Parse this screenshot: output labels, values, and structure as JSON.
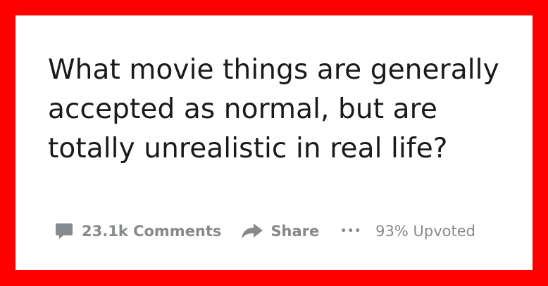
{
  "post": {
    "title": "What movie things are generally accepted as normal, but are totally unrealistic in real life?"
  },
  "actions": {
    "comments_label": "23.1k Comments",
    "share_label": "Share",
    "more_label": "•••",
    "upvoted_label": "93% Upvoted"
  },
  "icons": {
    "comments": "comment-bubble-icon",
    "share": "share-arrow-icon"
  },
  "colors": {
    "frame": "#ff0000",
    "card": "#ffffff",
    "title": "#1a1a1b",
    "meta": "#878a8c"
  }
}
